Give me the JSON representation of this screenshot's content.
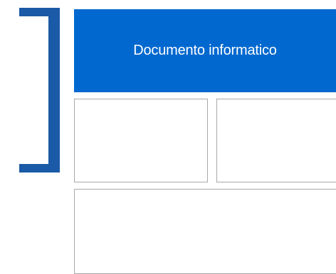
{
  "header": {
    "title": "Documento informatico",
    "background_color": "#0068cf",
    "text_color": "#ffffff"
  },
  "bracket": {
    "color": "#1b5aa6",
    "shape": "right-square-bracket"
  },
  "boxes": {
    "border_color": "#a8a8a8"
  }
}
